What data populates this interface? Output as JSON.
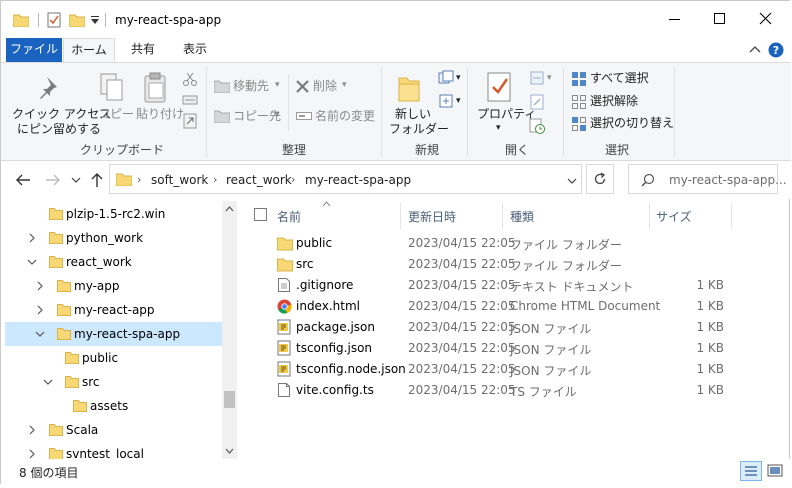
{
  "window": {
    "title": "my-react-spa-app",
    "accent_color": "#1b63c1",
    "folder_color": "#f8d775"
  },
  "tabs": [
    {
      "label": "ファイル"
    },
    {
      "label": "ホーム"
    },
    {
      "label": "共有"
    },
    {
      "label": "表示"
    }
  ],
  "ribbon": {
    "clipboard": {
      "pin_line1": "クイック アクセス",
      "pin_line2": "にピン留めする",
      "copy": "コピー",
      "paste": "貼り付け",
      "group_label": "クリップボード"
    },
    "organize": {
      "move_to": "移動先",
      "copy_to": "コピー先",
      "delete": "削除",
      "rename": "名前の変更",
      "group_label": "整理"
    },
    "new": {
      "new_folder_line1": "新しい",
      "new_folder_line2": "フォルダー",
      "group_label": "新規"
    },
    "open": {
      "properties": "プロパティ",
      "group_label": "開く"
    },
    "select": {
      "select_all": "すべて選択",
      "select_none": "選択解除",
      "invert": "選択の切り替え",
      "group_label": "選択"
    }
  },
  "address": {
    "breadcrumbs": [
      "soft_work",
      "react_work",
      "my-react-spa-app"
    ],
    "search_placeholder": "my-react-spa-app..."
  },
  "tree": [
    {
      "label": "plzip-1.5-rc2.win",
      "chevron": ""
    },
    {
      "label": "python_work",
      "chevron": "›"
    },
    {
      "label": "react_work",
      "chevron": "⌄"
    },
    {
      "label": "my-app",
      "chevron": "›"
    },
    {
      "label": "my-react-app",
      "chevron": "›"
    },
    {
      "label": "my-react-spa-app",
      "chevron": "⌄"
    },
    {
      "label": "public",
      "chevron": ""
    },
    {
      "label": "src",
      "chevron": "⌄"
    },
    {
      "label": "assets",
      "chevron": ""
    },
    {
      "label": "Scala",
      "chevron": "›"
    },
    {
      "label": "svntest_local",
      "chevron": "›"
    }
  ],
  "columns": {
    "name": "名前",
    "date": "更新日時",
    "type": "種類",
    "size": "サイズ"
  },
  "files": [
    {
      "name": "public",
      "date": "2023/04/15 22:05",
      "type": "ファイル フォルダー",
      "size": "",
      "icon": "folder-icon"
    },
    {
      "name": "src",
      "date": "2023/04/15 22:05",
      "type": "ファイル フォルダー",
      "size": "",
      "icon": "folder-icon"
    },
    {
      "name": ".gitignore",
      "date": "2023/04/15 22:05",
      "type": "テキスト ドキュメント",
      "size": "1 KB",
      "icon": "text-file-icon"
    },
    {
      "name": "index.html",
      "date": "2023/04/15 22:05",
      "type": "Chrome HTML Document",
      "size": "1 KB",
      "icon": "chrome-icon"
    },
    {
      "name": "package.json",
      "date": "2023/04/15 22:05",
      "type": "JSON ファイル",
      "size": "1 KB",
      "icon": "json-file-icon"
    },
    {
      "name": "tsconfig.json",
      "date": "2023/04/15 22:05",
      "type": "JSON ファイル",
      "size": "1 KB",
      "icon": "json-file-icon"
    },
    {
      "name": "tsconfig.node.json",
      "date": "2023/04/15 22:05",
      "type": "JSON ファイル",
      "size": "1 KB",
      "icon": "json-file-icon"
    },
    {
      "name": "vite.config.ts",
      "date": "2023/04/15 22:05",
      "type": "TS ファイル",
      "size": "1 KB",
      "icon": "ts-file-icon"
    }
  ],
  "status": {
    "item_count": "8 個の項目"
  }
}
